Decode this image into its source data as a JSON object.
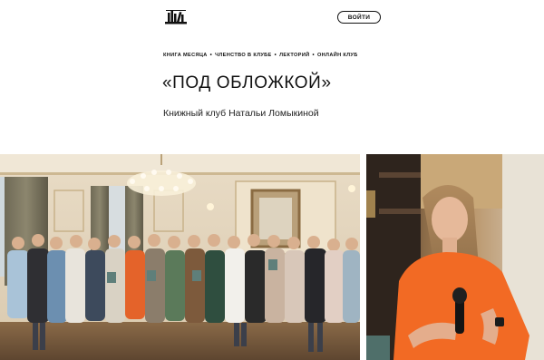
{
  "header": {
    "logo_icon": "bookshelf-logo-icon",
    "login_label": "ВОЙТИ"
  },
  "nav": {
    "items": [
      {
        "label": "КНИГА МЕСЯЦА"
      },
      {
        "label": "ЧЛЕНСТВО В КЛУБЕ"
      },
      {
        "label": "ЛЕКТОРИЙ"
      },
      {
        "label": "ОНЛАЙН КЛУБ"
      }
    ]
  },
  "hero": {
    "title": "«ПОД ОБЛОЖКОЙ»",
    "subtitle": "Книжный клуб Натальи Ломыкиной"
  },
  "colors": {
    "accent": "#111111",
    "background": "#ffffff"
  }
}
